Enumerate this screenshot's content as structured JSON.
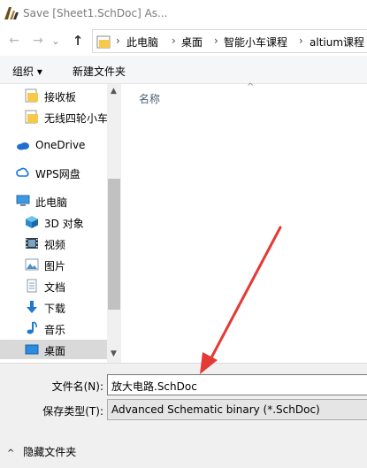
{
  "window": {
    "title": "Save [Sheet1.SchDoc] As..."
  },
  "nav": {
    "back_glyph": "←",
    "forward_glyph": "→",
    "history_glyph": "⌄",
    "up_glyph": "↑",
    "breadcrumbs": [
      "此电脑",
      "桌面",
      "智能小车课程",
      "altium课程"
    ],
    "separator": "›"
  },
  "toolbar": {
    "organize_label": "组织 ▾",
    "new_folder_label": "新建文件夹"
  },
  "sidebar": {
    "items": [
      {
        "label": "接收板",
        "icon": "folder-icon"
      },
      {
        "label": "无线四轮小车",
        "icon": "folder-icon"
      },
      {
        "label": "OneDrive",
        "icon": "cloud-icon"
      },
      {
        "label": "WPS网盘",
        "icon": "wps-cloud-icon"
      },
      {
        "label": "此电脑",
        "icon": "computer-icon"
      },
      {
        "label": "3D 对象",
        "icon": "cube-icon"
      },
      {
        "label": "视频",
        "icon": "video-icon"
      },
      {
        "label": "图片",
        "icon": "picture-icon"
      },
      {
        "label": "文档",
        "icon": "document-icon"
      },
      {
        "label": "下载",
        "icon": "download-icon"
      },
      {
        "label": "音乐",
        "icon": "music-icon"
      },
      {
        "label": "桌面",
        "icon": "desktop-icon"
      }
    ],
    "selected_index": 11
  },
  "content": {
    "column_name": "名称",
    "sort_glyph": "^"
  },
  "form": {
    "filename_label": "文件名(N):",
    "filename_value": "放大电路.SchDoc",
    "filetype_label": "保存类型(T):",
    "filetype_value": "Advanced Schematic binary (*.SchDoc)"
  },
  "footer": {
    "hide_folders_label": "隐藏文件夹",
    "chevron_glyph": "^"
  },
  "colors": {
    "accent": "#0078d7",
    "arrow": "#e53935",
    "folder": "#f7c948"
  }
}
